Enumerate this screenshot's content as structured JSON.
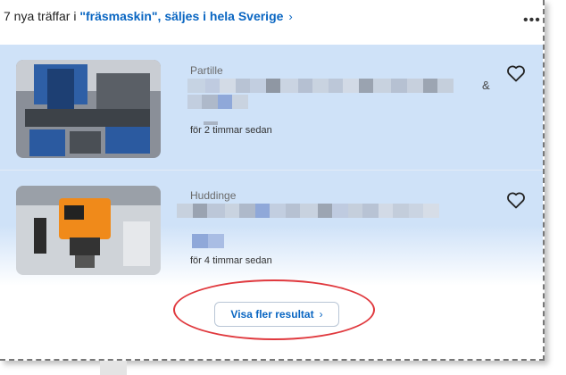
{
  "header": {
    "prefix": "7 nya träffar i ",
    "query": "\"fräsmaskin\", säljes i hela Sverige",
    "chevron": "›",
    "more_icon": "more-horizontal-icon",
    "more_glyph": "•••"
  },
  "results": [
    {
      "location": "Partille",
      "title_suffix": "&",
      "time": "för 2 timmar sedan"
    },
    {
      "location": "Huddinge",
      "time": "för 4 timmar sedan"
    }
  ],
  "load_more": {
    "label": "Visa fler resultat",
    "chevron": "›"
  },
  "colors": {
    "accent": "#0a66c2",
    "highlight_bg": "#cfe2f8",
    "annotation": "#e0393e"
  }
}
